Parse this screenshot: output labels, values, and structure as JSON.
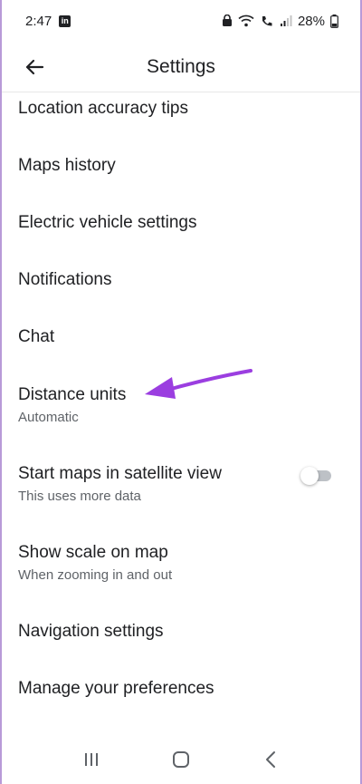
{
  "status_bar": {
    "time": "2:47",
    "app_badge": "in",
    "battery": "28%"
  },
  "header": {
    "title": "Settings"
  },
  "settings": [
    {
      "id": "location-accuracy-tips",
      "title": "Location accuracy tips"
    },
    {
      "id": "maps-history",
      "title": "Maps history"
    },
    {
      "id": "electric-vehicle-settings",
      "title": "Electric vehicle settings"
    },
    {
      "id": "notifications",
      "title": "Notifications"
    },
    {
      "id": "chat",
      "title": "Chat"
    },
    {
      "id": "distance-units",
      "title": "Distance units",
      "subtitle": "Automatic"
    },
    {
      "id": "satellite-view",
      "title": "Start maps in satellite view",
      "subtitle": "This uses more data",
      "toggle": false
    },
    {
      "id": "show-scale",
      "title": "Show scale on map",
      "subtitle": "When zooming in and out"
    },
    {
      "id": "navigation-settings",
      "title": "Navigation settings"
    },
    {
      "id": "manage-preferences",
      "title": "Manage your preferences"
    }
  ],
  "colors": {
    "annotation_arrow": "#9b3ee0",
    "toggle_off_track": "#bdc1c6"
  },
  "icons": {
    "back": "arrow-back-icon",
    "nav_recents": "recents-icon",
    "nav_home": "home-icon",
    "nav_back": "nav-back-icon"
  }
}
